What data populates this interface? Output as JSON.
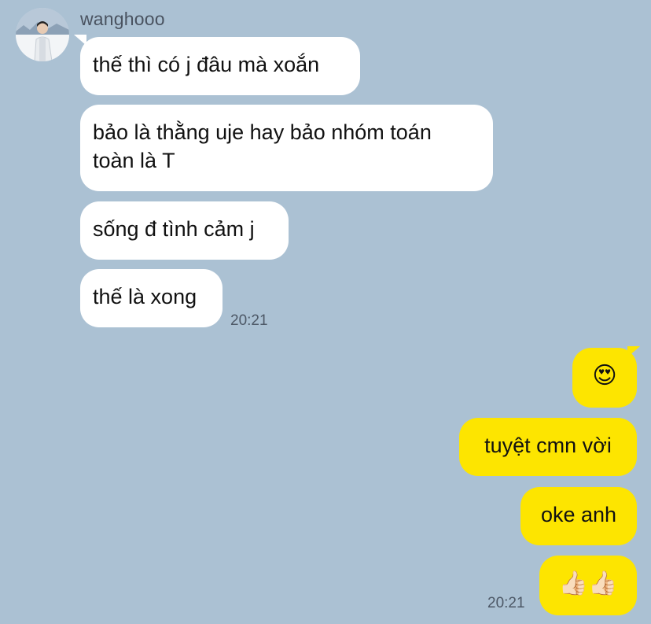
{
  "conversation": {
    "sender_name": "wanghooo",
    "incoming": [
      {
        "text": "thế thì có j đâu mà xoắn"
      },
      {
        "text": "bảo là thằng uje hay bảo nhóm toán\ntoàn là T"
      },
      {
        "text": "sống đ tình cảm j"
      },
      {
        "text": "thế là xong"
      }
    ],
    "incoming_time": "20:21",
    "outgoing": [
      {
        "text": "😍"
      },
      {
        "text": "tuyệt cmn vời"
      },
      {
        "text": "oke anh"
      },
      {
        "text": "👍🏻👍🏻"
      }
    ],
    "outgoing_time": "20:21"
  },
  "colors": {
    "background": "#abc1d3",
    "incoming_bubble": "#ffffff",
    "outgoing_bubble": "#fde500",
    "timestamp": "#4d5866"
  }
}
